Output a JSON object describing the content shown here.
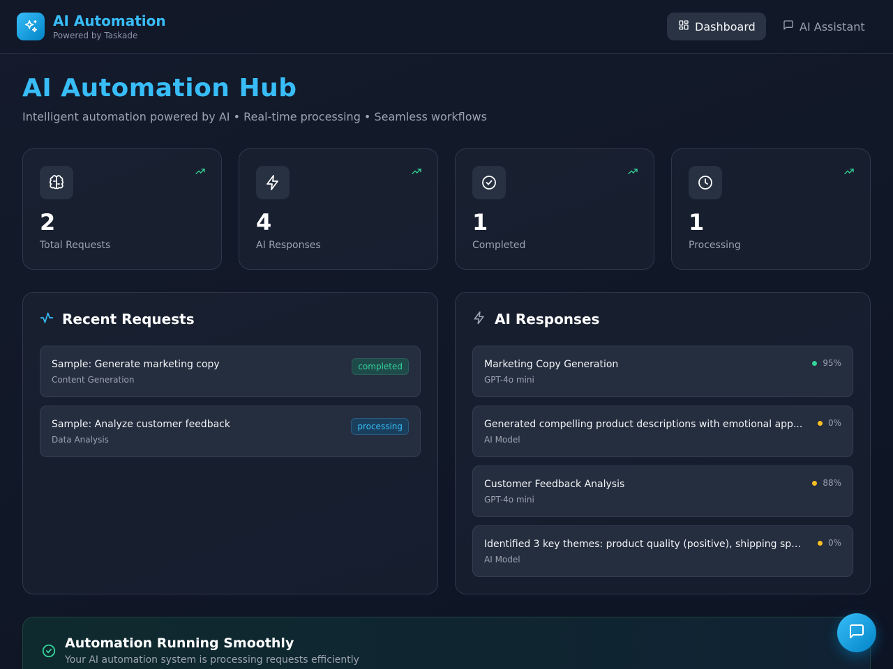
{
  "header": {
    "brand_title": "AI Automation",
    "brand_subtitle": "Powered by Taskade",
    "nav": [
      {
        "label": "Dashboard",
        "icon": "grid-icon",
        "active": true
      },
      {
        "label": "AI Assistant",
        "icon": "chat-icon",
        "active": false
      }
    ]
  },
  "hero": {
    "title": "AI Automation Hub",
    "subtitle": "Intelligent automation powered by AI • Real-time processing • Seamless workflows"
  },
  "stats": [
    {
      "value": "2",
      "label": "Total Requests",
      "icon": "brain-icon"
    },
    {
      "value": "4",
      "label": "AI Responses",
      "icon": "lightning-icon"
    },
    {
      "value": "1",
      "label": "Completed",
      "icon": "check-circle-icon"
    },
    {
      "value": "1",
      "label": "Processing",
      "icon": "clock-icon"
    }
  ],
  "recent_requests": {
    "title": "Recent Requests",
    "items": [
      {
        "title": "Sample: Generate marketing copy",
        "category": "Content Generation",
        "status": "completed"
      },
      {
        "title": "Sample: Analyze customer feedback",
        "category": "Data Analysis",
        "status": "processing"
      }
    ]
  },
  "ai_responses": {
    "title": "AI Responses",
    "items": [
      {
        "title": "Marketing Copy Generation",
        "model": "GPT-4o mini",
        "confidence": "95%",
        "dot_color": "#34d399"
      },
      {
        "title": "Generated compelling product descriptions with emotional app...",
        "model": "AI Model",
        "confidence": "0%",
        "dot_color": "#fbbf24"
      },
      {
        "title": "Customer Feedback Analysis",
        "model": "GPT-4o mini",
        "confidence": "88%",
        "dot_color": "#fbbf24"
      },
      {
        "title": "Identified 3 key themes: product quality (positive), shipping spe...",
        "model": "AI Model",
        "confidence": "0%",
        "dot_color": "#fbbf24"
      }
    ]
  },
  "status": {
    "title": "Automation Running Smoothly",
    "subtitle": "Your AI automation system is processing requests efficiently"
  },
  "colors": {
    "accent": "#38bdf8",
    "success": "#34d399",
    "warning": "#fbbf24",
    "background": "#111827"
  }
}
